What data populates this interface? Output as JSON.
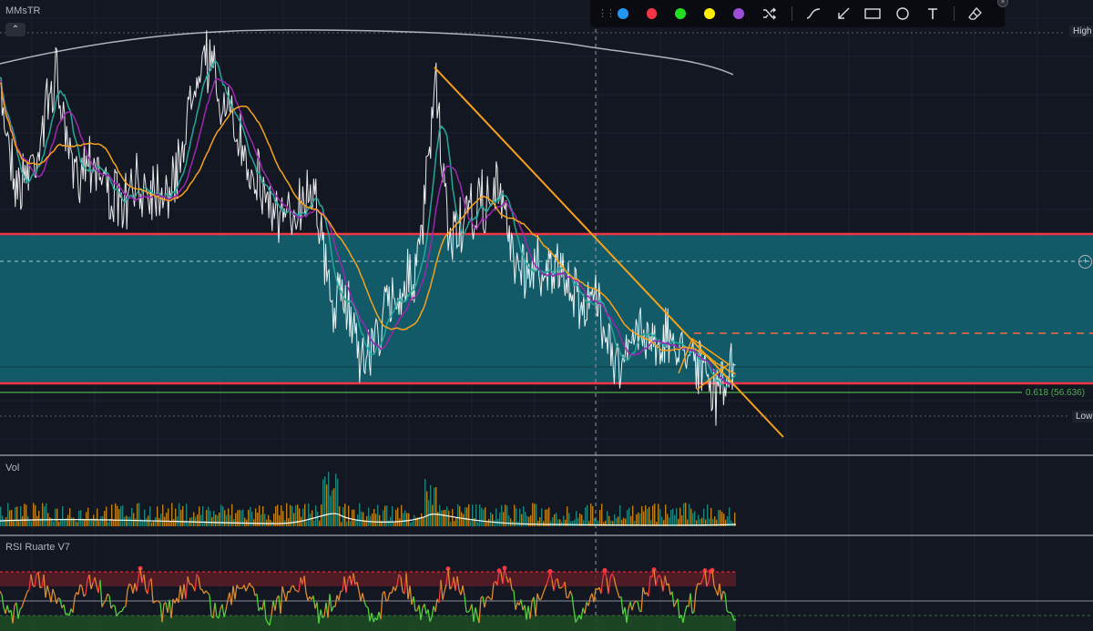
{
  "main_pane": {
    "title": "MMsTR",
    "collapse_icon": "chevron-up-icon"
  },
  "price_scale": {
    "high_label": "High",
    "low_label": "Low"
  },
  "fib": {
    "label": "0.618 (56.636)"
  },
  "vol_pane": {
    "title": "Vol"
  },
  "rsi_pane": {
    "title": "RSI Ruarte V7"
  },
  "toolbar": {
    "colors": [
      "#2196f3",
      "#f23645",
      "#22dd22",
      "#ffee00",
      "#9c4fd6"
    ],
    "tools": [
      "shuffle-icon",
      "trend-line-icon",
      "arrow-icon",
      "rectangle-icon",
      "circle-icon",
      "text-icon",
      "eraser-icon"
    ]
  },
  "theme": {
    "background": "#131722",
    "zone_fill": "#136673",
    "zone_border": "#f23645",
    "trendline": "#f7a21b",
    "ema_fast": "#26a69a",
    "ema_mid": "#9c27b0",
    "ema_slow": "#f7a21b",
    "price": "#ffffff",
    "fib_line": "#4caf50",
    "rsi_overbought": "#f23645",
    "rsi_oversold": "#22aa22"
  }
}
